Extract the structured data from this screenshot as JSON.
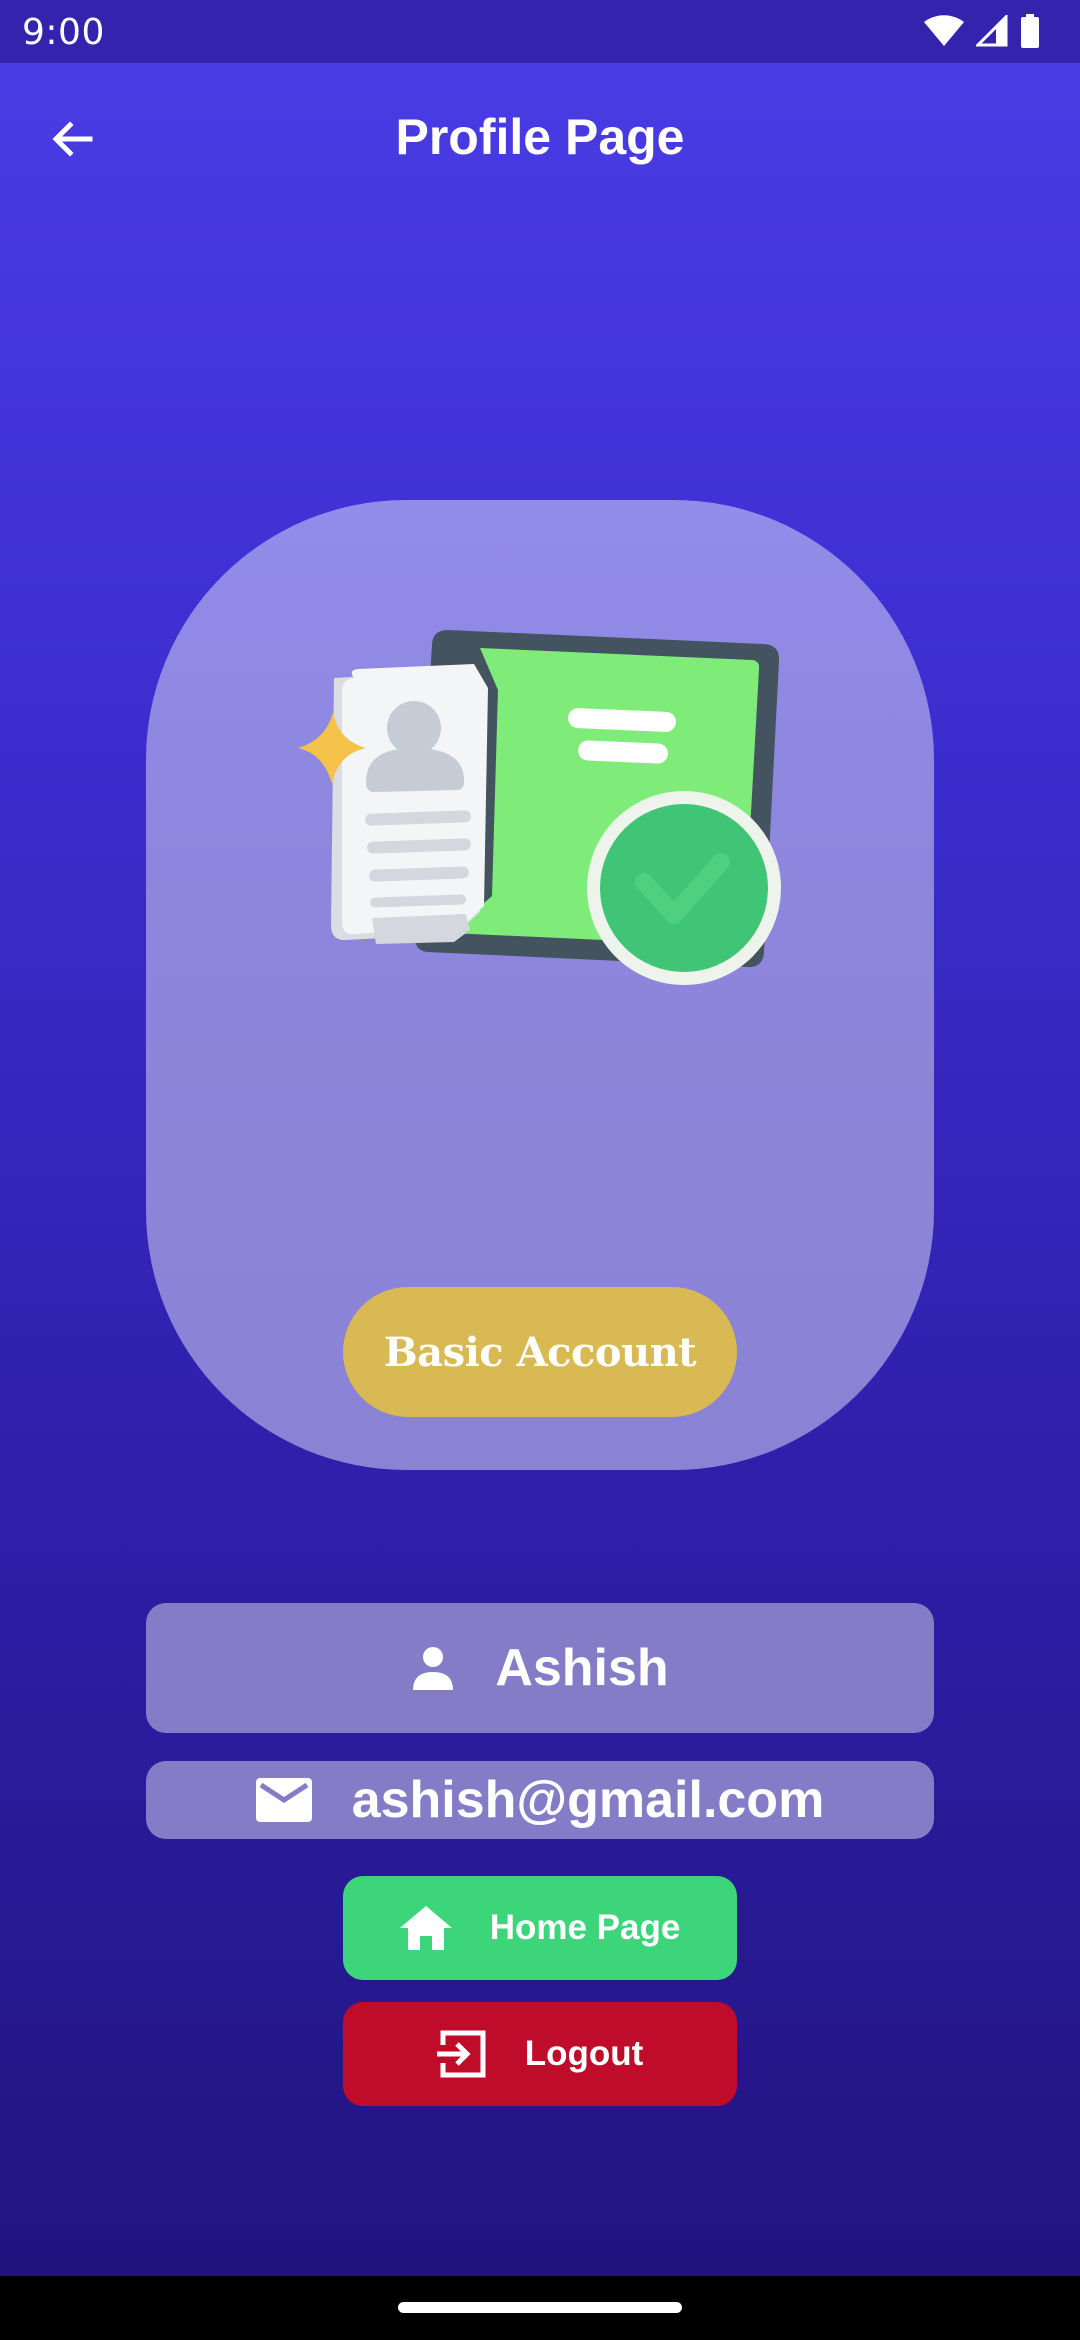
{
  "status_bar": {
    "time": "9:00",
    "icons": [
      "wifi-icon",
      "cell-signal-icon",
      "battery-icon"
    ]
  },
  "app_bar": {
    "title": "Profile Page",
    "back_icon": "arrow-back-icon"
  },
  "profile_card": {
    "illustration": "verified-id-document-illustration",
    "account_type": "Basic Account"
  },
  "user": {
    "name": "Ashish",
    "name_icon": "person-icon",
    "email": "ashish@gmail.com",
    "email_icon": "mail-icon"
  },
  "actions": {
    "home_label": "Home Page",
    "home_icon": "home-icon",
    "logout_label": "Logout",
    "logout_icon": "login-arrow-icon"
  },
  "colors": {
    "background_top": "#4a3de6",
    "background_bottom": "#21137b",
    "card": "#8d86dd",
    "badge": "#d9b953",
    "field": "#847cc6",
    "home_button": "#3dd57a",
    "logout_button": "#bf0c2b"
  }
}
